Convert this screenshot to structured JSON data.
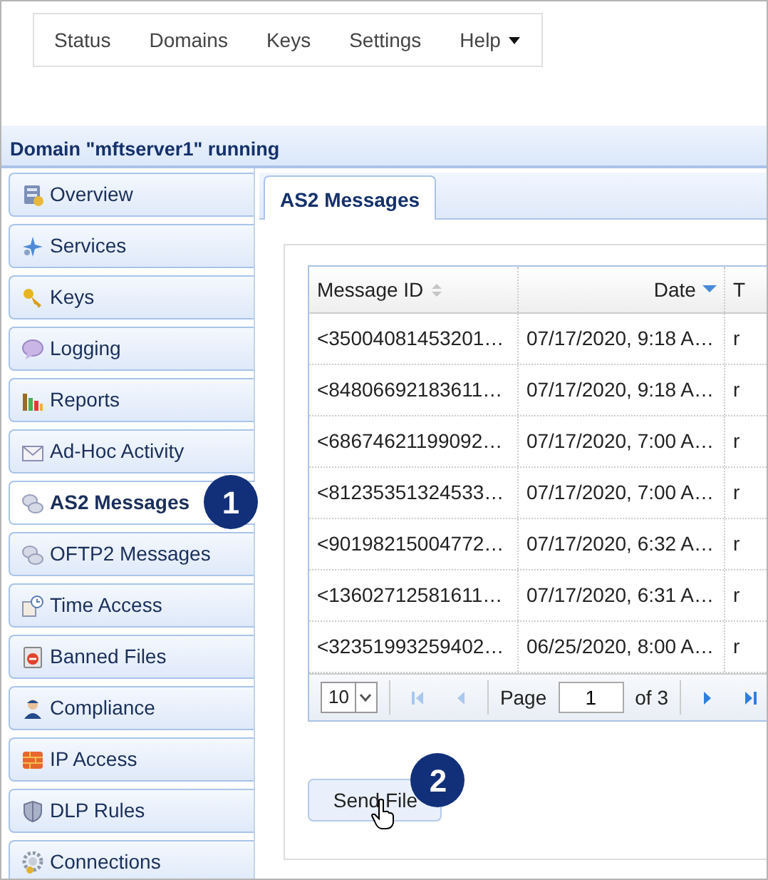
{
  "top_menu": [
    {
      "label": "Status",
      "kind": "link"
    },
    {
      "label": "Domains",
      "kind": "link"
    },
    {
      "label": "Keys",
      "kind": "link"
    },
    {
      "label": "Settings",
      "kind": "link"
    },
    {
      "label": "Help",
      "kind": "dropdown"
    }
  ],
  "domain_header": "Domain \"mftserver1\" running",
  "sidebar": {
    "items": [
      {
        "label": "Overview",
        "selected": false
      },
      {
        "label": "Services",
        "selected": false
      },
      {
        "label": "Keys",
        "selected": false
      },
      {
        "label": "Logging",
        "selected": false
      },
      {
        "label": "Reports",
        "selected": false
      },
      {
        "label": "Ad-Hoc Activity",
        "selected": false
      },
      {
        "label": "AS2 Messages",
        "selected": true,
        "step": "1"
      },
      {
        "label": "OFTP2 Messages",
        "selected": false
      },
      {
        "label": "Time Access",
        "selected": false
      },
      {
        "label": "Banned Files",
        "selected": false
      },
      {
        "label": "Compliance",
        "selected": false
      },
      {
        "label": "IP Access",
        "selected": false
      },
      {
        "label": "DLP Rules",
        "selected": false
      },
      {
        "label": "Connections",
        "selected": false
      }
    ]
  },
  "tabs": [
    {
      "label": "AS2 Messages",
      "selected": true
    }
  ],
  "table": {
    "columns": [
      {
        "label": "Message ID",
        "kind": "sortable"
      },
      {
        "label": "Date",
        "kind": "sorted"
      },
      {
        "label": "T",
        "kind": "plain"
      }
    ],
    "rows": [
      [
        "<35004081453201…",
        "07/17/2020, 9:18 A…",
        "r"
      ],
      [
        "<84806692183611…",
        "07/17/2020, 9:18 A…",
        "r"
      ],
      [
        "<68674621199092…",
        "07/17/2020, 7:00 A…",
        "r"
      ],
      [
        "<81235351324533…",
        "07/17/2020, 7:00 A…",
        "r"
      ],
      [
        "<90198215004772…",
        "07/17/2020, 6:32 A…",
        "r"
      ],
      [
        "<13602712581611…",
        "07/17/2020, 6:31 A…",
        "r"
      ],
      [
        "<32351993259402…",
        "06/25/2020, 8:00 A…",
        "r"
      ]
    ]
  },
  "pager": {
    "page_size": "10",
    "page_label": "Page",
    "page": "1",
    "of_label": "of 3"
  },
  "send_button": {
    "label": "Send File",
    "step": "2"
  }
}
